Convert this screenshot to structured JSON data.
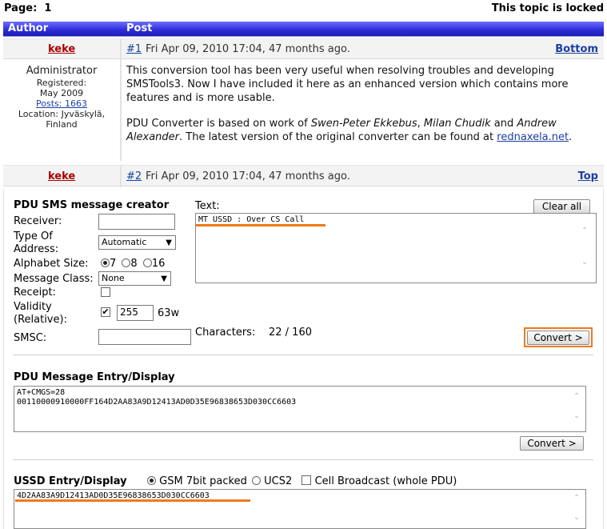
{
  "page": {
    "label": "Page:",
    "number": "1",
    "locked_text": "This topic is locked"
  },
  "table_header": {
    "author": "Author",
    "post": "Post"
  },
  "post1": {
    "author": "keke",
    "number": "#1",
    "date": "Fri Apr 09, 2010 17:04, 47 months ago.",
    "nav": "Bottom",
    "author_role": "Administrator",
    "registered_label": "Registered:",
    "registered_date": "May 2009",
    "posts": "Posts: 1663",
    "location": "Location: Jyväskylä, Finland",
    "para1": "This conversion tool has been very useful when resolving troubles and developing SMSTools3. Now I have included it here as an enhanced version which contains more features and is more usable.",
    "para2_a": "PDU Converter is based on work of ",
    "para2_name1": "Swen-Peter Ekkebus",
    "para2_sep1": ", ",
    "para2_name2": "Milan Chudik",
    "para2_and": " and ",
    "para2_name3": "Andrew Alexander",
    "para2_b": ". The latest version of the original converter can be found at ",
    "para2_link": "rednaxela.net",
    "para2_end": "."
  },
  "post2": {
    "author": "keke",
    "number": "#2",
    "date": "Fri Apr 09, 2010 17:04, 47 months ago.",
    "nav": "Top"
  },
  "creator": {
    "title": "PDU SMS message creator",
    "receiver_label": "Receiver:",
    "receiver_value": "",
    "type_label_1": "Type Of",
    "type_label_2": "Address:",
    "type_value": "Automatic",
    "alphabet_label": "Alphabet Size:",
    "alphabet_options": [
      "7",
      "8",
      "16"
    ],
    "alphabet_selected": "7",
    "class_label": "Message Class:",
    "class_value": "None",
    "receipt_label": "Receipt:",
    "validity_label_1": "Validity",
    "validity_label_2": "(Relative):",
    "validity_value": "255",
    "validity_unit": "63w",
    "smsc_label": "SMSC:",
    "smsc_value": "",
    "text_label": "Text:",
    "clear_all": "Clear all",
    "text_value": "MT USSD : Over CS Call",
    "characters_label": "Characters:",
    "characters_value": "22 / 160",
    "convert": "Convert >"
  },
  "pdu_entry": {
    "title": "PDU Message Entry/Display",
    "line1": "AT+CMGS=28",
    "line2": "00110000910000FF164D2AA83A9D12413AD0D35E96838653D030CC6603",
    "convert": "Convert >"
  },
  "ussd": {
    "title": "USSD Entry/Display",
    "opt_gsm": "GSM 7bit packed",
    "opt_ucs2": "UCS2",
    "opt_cb": "Cell Broadcast (whole PDU)",
    "selected": "GSM 7bit packed",
    "value": "4D2AA83A9D12413AD0D35E96838653D030CC6603"
  },
  "colors": {
    "header_blue": "#2b2bd8",
    "author_red": "#aa0000",
    "link_blue": "#1b3fa0",
    "highlight_orange": "#f07a1a"
  }
}
